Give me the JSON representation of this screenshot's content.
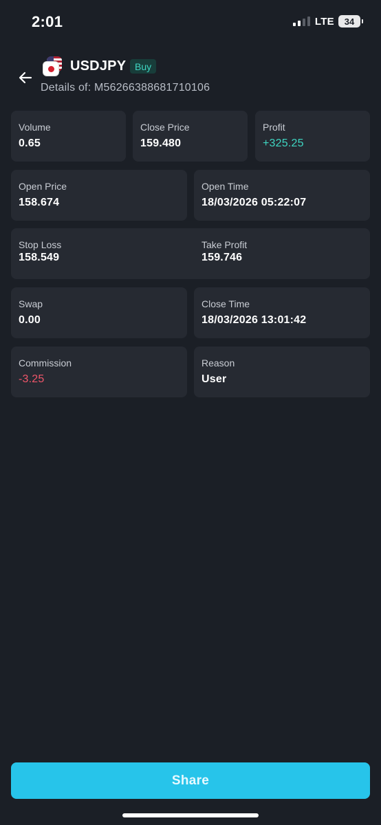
{
  "status_bar": {
    "time": "2:01",
    "network": "LTE",
    "battery": "34"
  },
  "header": {
    "symbol": "USDJPY",
    "side": "Buy",
    "details": "Details of: M56266388681710106"
  },
  "fields": {
    "volume": {
      "label": "Volume",
      "value": "0.65"
    },
    "close_price": {
      "label": "Close Price",
      "value": "159.480"
    },
    "profit": {
      "label": "Profit",
      "value": "+325.25"
    },
    "open_price": {
      "label": "Open Price",
      "value": "158.674"
    },
    "open_time": {
      "label": "Open Time",
      "value": "18/03/2026 05:22:07"
    },
    "stop_loss": {
      "label": "Stop Loss",
      "value": "158.549"
    },
    "take_profit": {
      "label": "Take Profit",
      "value": "159.746"
    },
    "swap": {
      "label": "Swap",
      "value": "0.00"
    },
    "close_time": {
      "label": "Close Time",
      "value": "18/03/2026 13:01:42"
    },
    "commission": {
      "label": "Commission",
      "value": "-3.25"
    },
    "reason": {
      "label": "Reason",
      "value": "User"
    }
  },
  "actions": {
    "share_label": "Share"
  },
  "colors": {
    "background": "#1b1f26",
    "card": "#262a32",
    "positive": "#3fd6c2",
    "negative": "#f0566a",
    "accent": "#27c4ea"
  },
  "icons": {
    "back": "arrow-left-icon",
    "pair": "usd-jpy-flags-icon",
    "signal": "cellular-signal-icon",
    "battery": "battery-icon"
  }
}
